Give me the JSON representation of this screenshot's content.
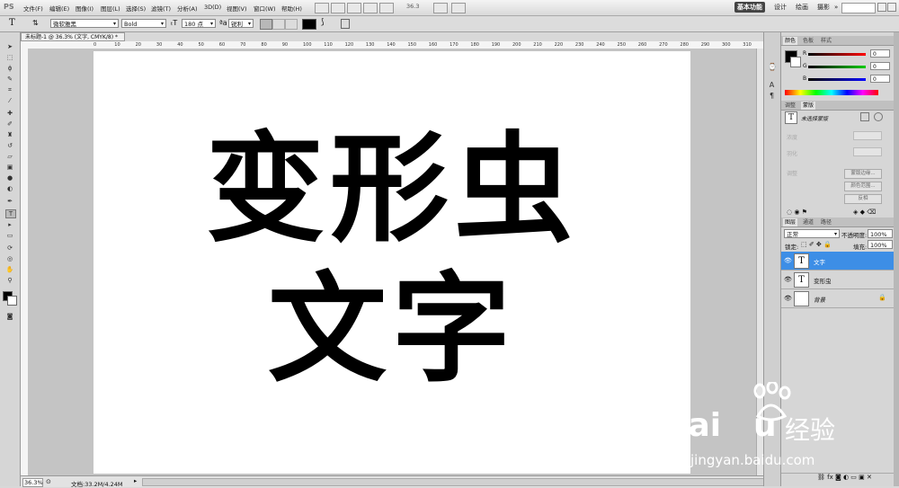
{
  "app": {
    "logo": "PS"
  },
  "menu": [
    "文件(F)",
    "编辑(E)",
    "图像(I)",
    "图层(L)",
    "选择(S)",
    "滤镜(T)",
    "分析(A)",
    "3D(D)",
    "视图(V)",
    "窗口(W)",
    "帮助(H)"
  ],
  "menubar": {
    "zoom": "36.3"
  },
  "workspace": {
    "items": [
      "基本功能",
      "设计",
      "绘画",
      "摄影"
    ],
    "more": "»"
  },
  "options": {
    "tool_glyph": "T",
    "font_family": "微软雅黑",
    "font_style": "Bold",
    "font_size": "180 点",
    "antialias": "锐利",
    "color": "#000000"
  },
  "document": {
    "tab_title": "未标题-1 @ 36.3% (文字, CMYK/8) *",
    "ruler_ticks": [
      "0",
      "10",
      "20",
      "30",
      "40",
      "50",
      "60",
      "70",
      "80",
      "90",
      "100",
      "110",
      "120",
      "130",
      "140",
      "150",
      "160",
      "170",
      "180",
      "190",
      "200",
      "210",
      "220",
      "230",
      "240",
      "250",
      "260",
      "270",
      "280",
      "290",
      "300",
      "310"
    ],
    "canvas_lines": [
      "变形虫",
      "文字"
    ]
  },
  "status": {
    "zoom": "36.3%",
    "doc_info": "文档:33.2M/4.24M"
  },
  "color_panel": {
    "tabs": [
      "颜色",
      "色板",
      "样式"
    ],
    "channels": [
      {
        "label": "R",
        "value": "0"
      },
      {
        "label": "G",
        "value": "0"
      },
      {
        "label": "B",
        "value": "0"
      }
    ]
  },
  "adjust_panel": {
    "tabs": [
      "调整",
      "蒙版"
    ],
    "title": "未选择蒙版",
    "density_label": "浓度",
    "feather_label": "羽化",
    "refine_label": "调整",
    "buttons": [
      "蒙版边缘...",
      "颜色范围...",
      "反相"
    ]
  },
  "layers_panel": {
    "tabs": [
      "图层",
      "通道",
      "路径"
    ],
    "blend_mode": "正常",
    "opacity_label": "不透明度:",
    "opacity_value": "100%",
    "lock_label": "锁定:",
    "fill_label": "填充:",
    "fill_value": "100%",
    "layers": [
      {
        "name": "文字",
        "thumb": "T",
        "selected": true
      },
      {
        "name": "变形虫",
        "thumb": "T",
        "selected": false
      },
      {
        "name": "背景",
        "thumb": "",
        "selected": false
      }
    ]
  },
  "watermark": {
    "brand": "Bai",
    "brand_end": "u",
    "cn": "经验",
    "url": "jingyan.baidu.com"
  }
}
